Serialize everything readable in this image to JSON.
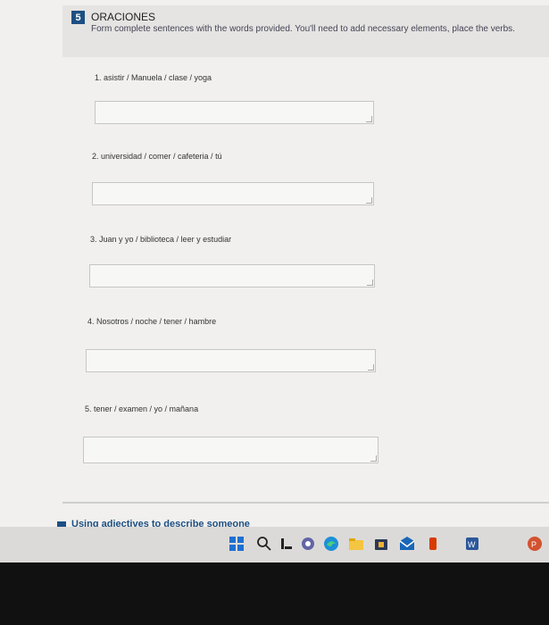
{
  "section": {
    "number": "5",
    "title": "ORACIONES",
    "instructions": "Form complete sentences with the words provided. You'll need to add necessary elements, place the verbs."
  },
  "questions": [
    {
      "prompt": "1. asistir / Manuela / clase / yoga",
      "answer": ""
    },
    {
      "prompt": "2. universidad / comer / cafeteria / tú",
      "answer": ""
    },
    {
      "prompt": "3. Juan y yo / biblioteca / leer y estudiar",
      "answer": ""
    },
    {
      "prompt": "4. Nosotros / noche / tener / hambre",
      "answer": ""
    },
    {
      "prompt": "5. tener / examen / yo / mañana",
      "answer": ""
    }
  ],
  "next_section": {
    "title": "Using adjectives to describe someone"
  },
  "taskbar": {
    "icons": [
      "windows-start-icon",
      "search-icon",
      "task-view-icon",
      "teams-icon",
      "edge-icon",
      "file-explorer-icon",
      "store-icon",
      "mail-icon",
      "office-icon",
      "word-icon",
      "powerpoint-icon"
    ],
    "accent": "#1d4f83"
  }
}
